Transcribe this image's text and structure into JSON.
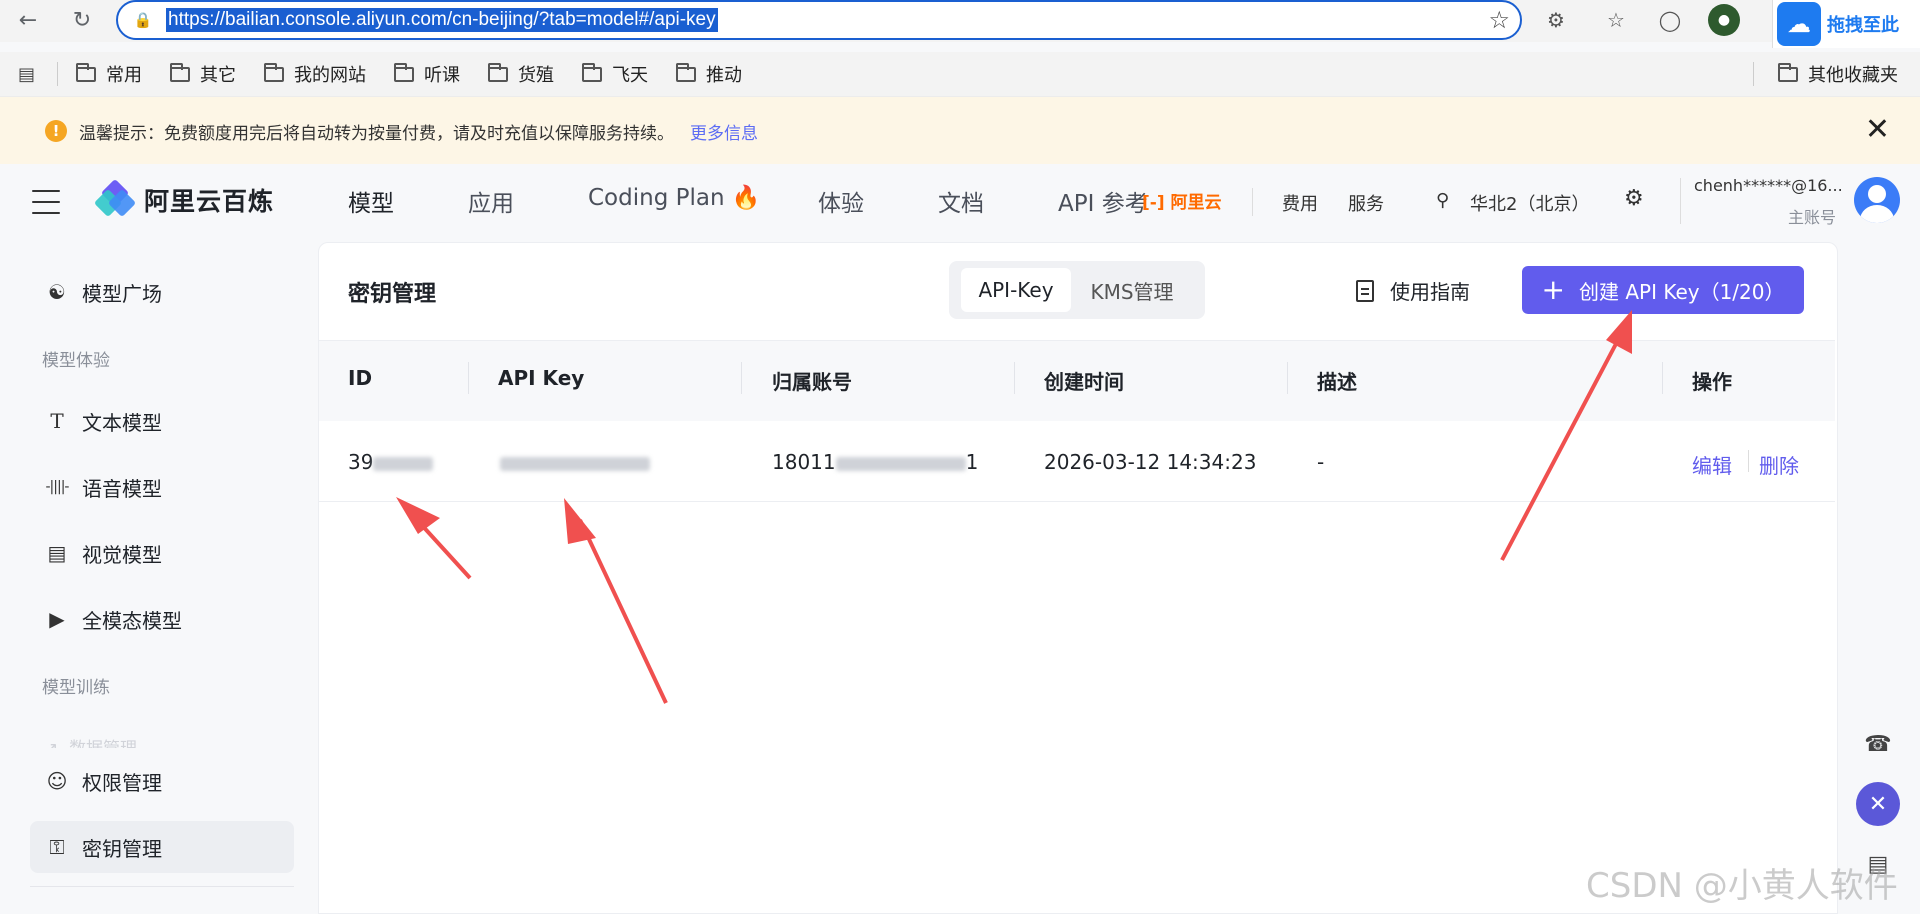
{
  "browser": {
    "url": "https://bailian.console.aliyun.com/cn-beijing/?tab=model#/api-key",
    "extension_label": "拖拽至此",
    "bookmarks": [
      "常用",
      "其它",
      "我的网站",
      "听课",
      "货殖",
      "飞天",
      "推动"
    ],
    "other_bookmarks": "其他收藏夹"
  },
  "notice": {
    "text": "温馨提示：免费额度用完后将自动转为按量付费，请及时充值以保障服务持续。",
    "more_link": "更多信息"
  },
  "header": {
    "brand": "阿里云百炼",
    "nav": [
      "模型",
      "应用",
      "Coding Plan 🔥",
      "体验",
      "文档",
      "API 参考"
    ],
    "aliyun_logo": "阿里云",
    "fees": "费用",
    "services": "服务",
    "region": "华北2（北京）",
    "account_name": "chenh******@16...",
    "account_type": "主账号"
  },
  "sidebar": {
    "items": [
      {
        "label": "模型广场",
        "icon": "model-square-icon"
      },
      {
        "label": "文本模型",
        "icon": "text-model-icon"
      },
      {
        "label": "语音模型",
        "icon": "audio-model-icon"
      },
      {
        "label": "视觉模型",
        "icon": "camera-icon"
      },
      {
        "label": "全模态模型",
        "icon": "multimodal-icon"
      },
      {
        "label": "数据管理",
        "icon": "chart-icon"
      },
      {
        "label": "权限管理",
        "icon": "user-icon"
      },
      {
        "label": "密钥管理",
        "icon": "key-icon"
      }
    ],
    "groups": [
      "模型体验",
      "模型训练"
    ]
  },
  "main": {
    "title": "密钥管理",
    "tabs": [
      "API-Key",
      "KMS管理"
    ],
    "guide": "使用指南",
    "create_button": "创建 API Key（1/20）",
    "table": {
      "headers": [
        "ID",
        "API Key",
        "归属账号",
        "创建时间",
        "描述",
        "操作"
      ],
      "rows": [
        {
          "id": "39",
          "api_key": "",
          "account_prefix": "18011",
          "account_suffix": "1",
          "created": "2026-03-12 14:34:23",
          "desc": "-",
          "edit": "编辑",
          "delete": "删除"
        }
      ]
    }
  },
  "watermark": "CSDN @小黄人软件",
  "colors": {
    "accent": "#615ced",
    "arrow": "#f0504f",
    "notice_bg": "#fdf6e6"
  }
}
